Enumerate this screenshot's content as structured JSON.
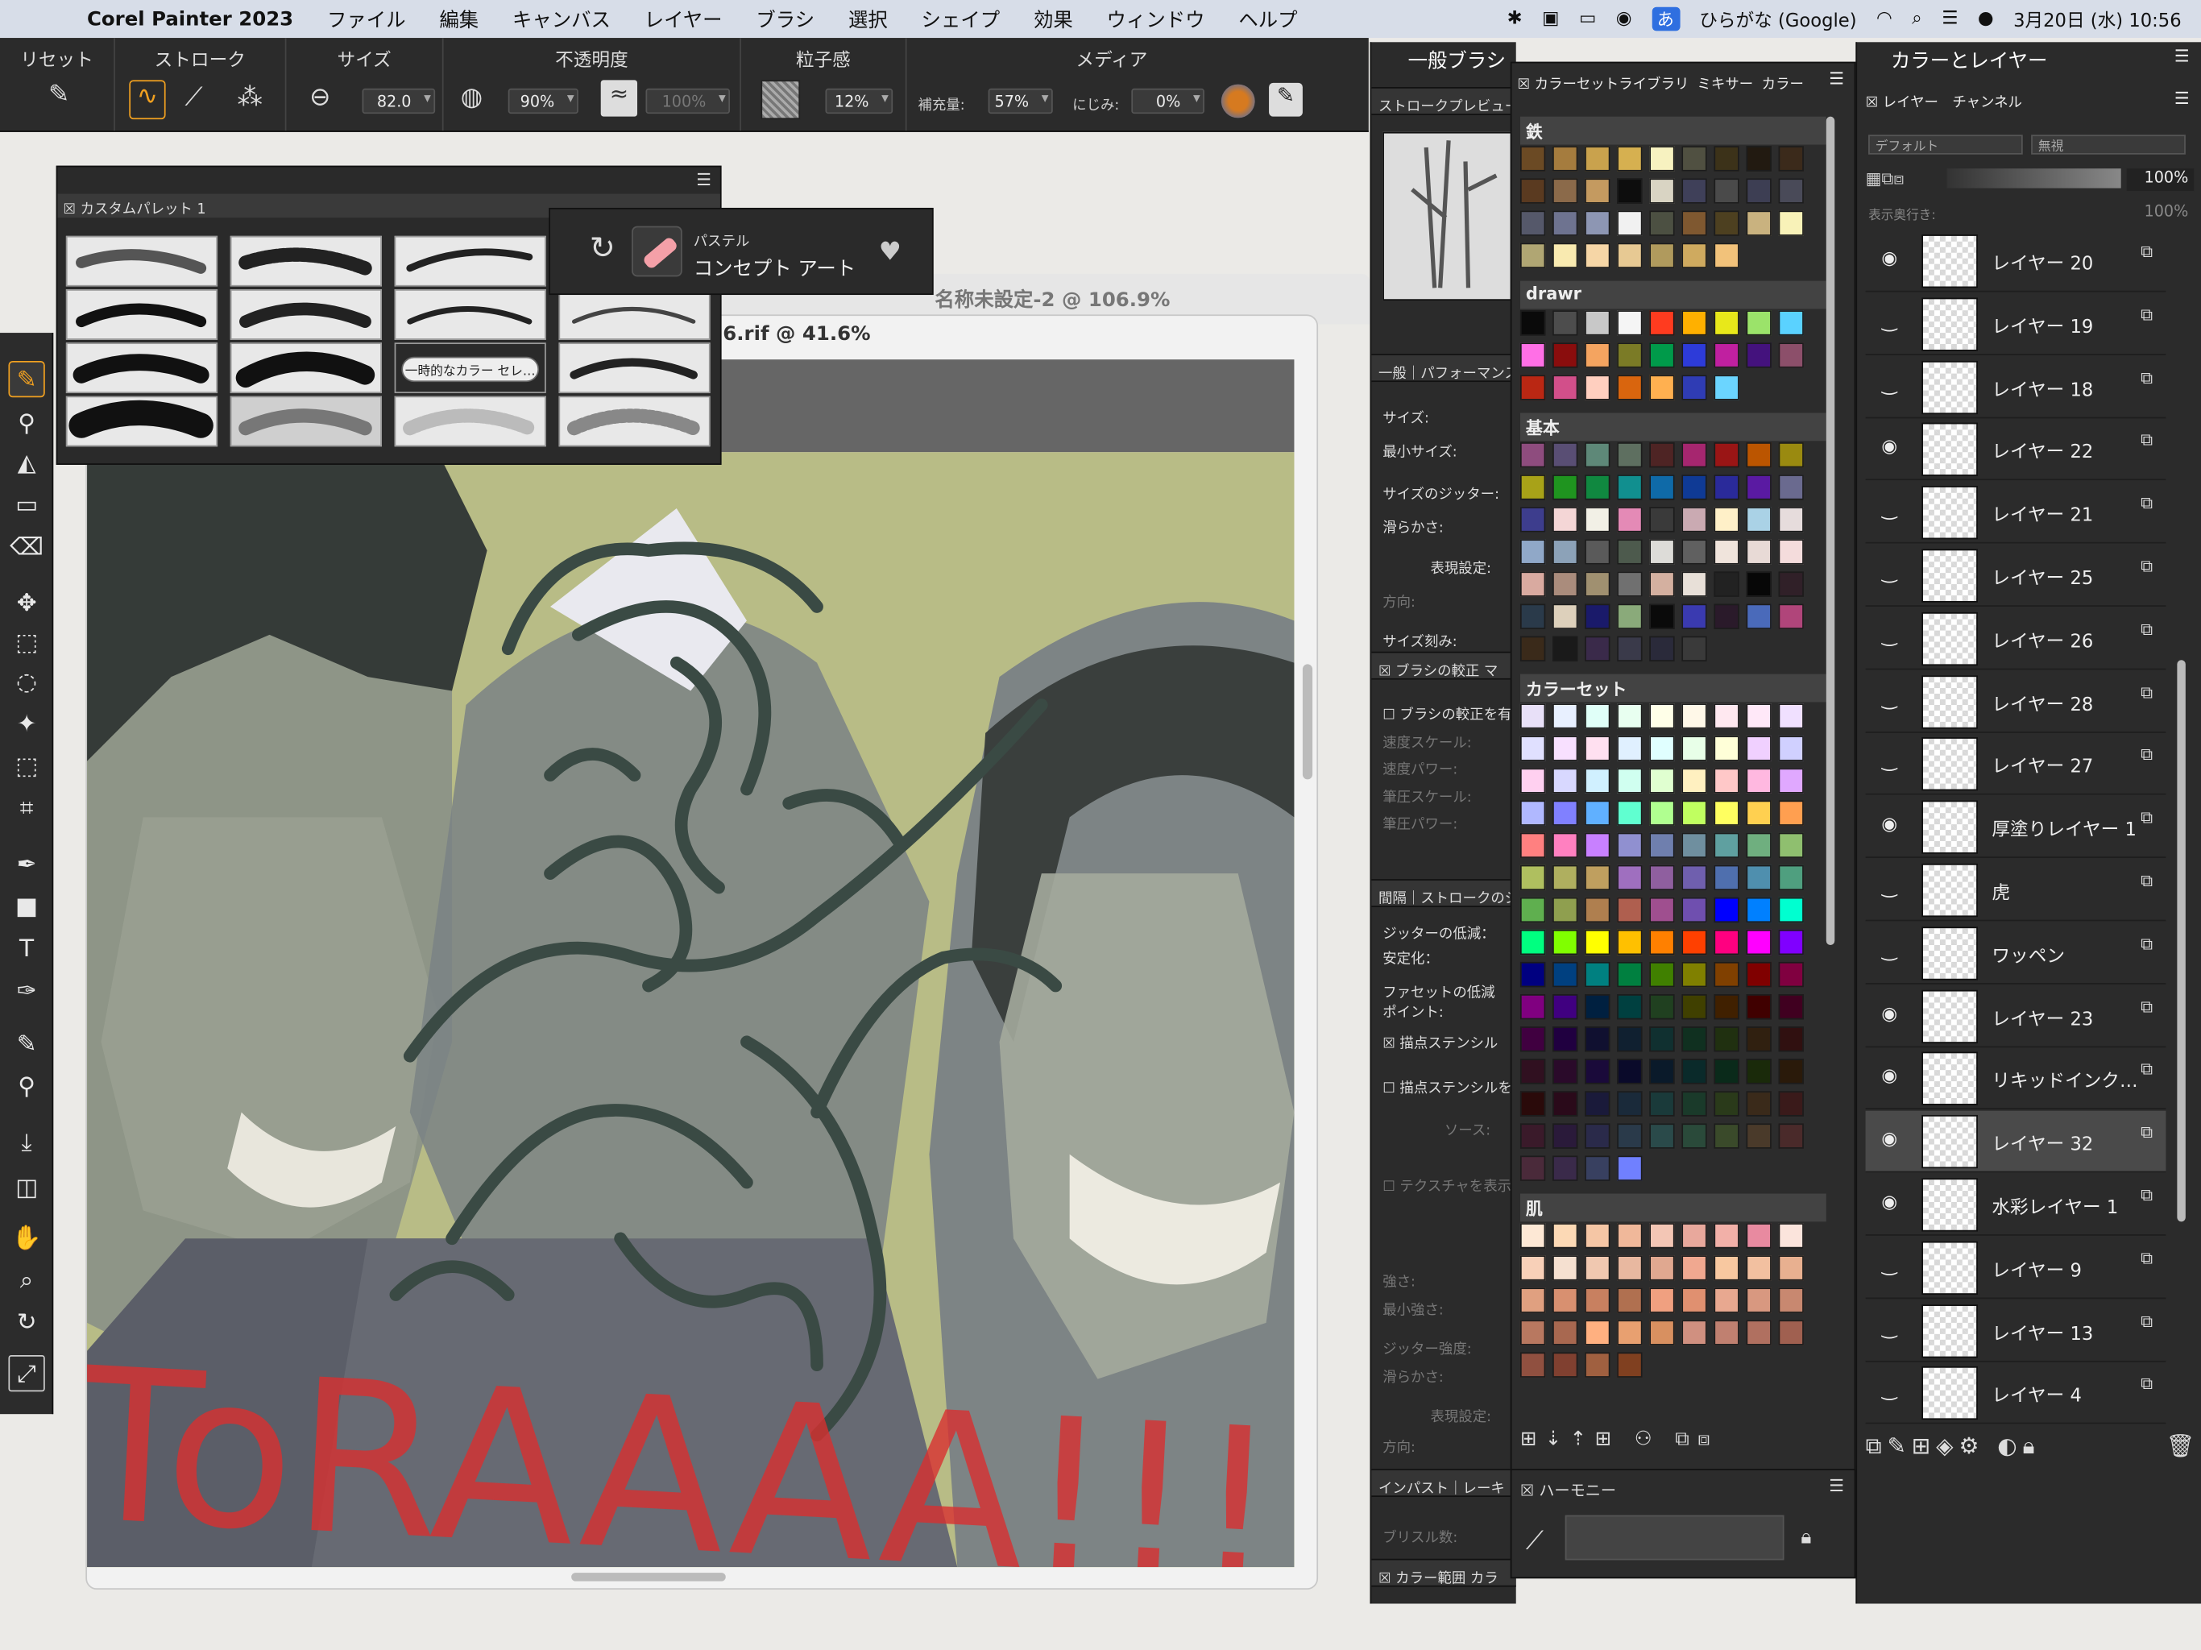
{
  "menubar": {
    "app_name": "Corel Painter 2023",
    "items": [
      "ファイル",
      "編集",
      "キャンバス",
      "レイヤー",
      "ブラシ",
      "選択",
      "シェイプ",
      "効果",
      "ウィンドウ",
      "ヘルプ"
    ],
    "ime_badge": "あ",
    "input_method": "ひらがな (Google)",
    "datetime": "3月20日 (水)  10:56"
  },
  "propbar": {
    "reset_label": "リセット",
    "stroke_label": "ストローク",
    "size_label": "サイズ",
    "size_value": "82.0",
    "opacity_label": "不透明度",
    "opacity_value": "90%",
    "opacity2_value": "100%",
    "grain_label": "粒子感",
    "grain_value": "12%",
    "media_label": "メディア",
    "resaturation_label": "補充量:",
    "resaturation_value": "57%",
    "bleed_label": "にじみ:",
    "bleed_value": "0%"
  },
  "document": {
    "back_title": "名称未設定-2 @ 106.9%",
    "title": "6.rif @ 41.6%",
    "handwriting": "ToRAAAA!!!"
  },
  "custom_palette": {
    "title": "カスタムパレット 1",
    "temp_color_label": "一時的なカラー セレ…"
  },
  "brush_selector": {
    "category": "パステル",
    "variant": "コンセプト アート"
  },
  "general_brush": {
    "title": "一般ブラシ",
    "stroke_preview": "ストロークプレビュー",
    "tabs": [
      "一般",
      "パフォーマンス"
    ],
    "rows": [
      "サイズ:",
      "最小サイズ:",
      "サイズのジッター:",
      "滑らかさ:",
      "表現設定:",
      "方向:",
      "サイズ刻み:"
    ],
    "calib_header": "ブラシの較正",
    "calib_tab": "マ",
    "calib_check": "ブラシの較正を有",
    "calib_rows": [
      "速度スケール:",
      "速度パワー:",
      "筆圧スケール:",
      "筆圧パワー:"
    ],
    "spacing_header": "間隔",
    "stroke_jitter": "ストロークのジ",
    "jitter_reduce": "ジッターの低減：",
    "stabilize": "安定化：",
    "facet_reduce": "ファセットの低減",
    "point": "ポイント:",
    "dab_stencil_header": "描点ステンシル",
    "dab_stencil_check": "描点ステンシルを",
    "source": "ソース:",
    "texture_check": "テクスチャを表示",
    "lower_rows": [
      "強さ:",
      "最小強さ:",
      "ジッター強度:",
      "滑らかさ:",
      "表現設定:",
      "方向:"
    ],
    "impasto_tab": "インパスト",
    "rake_tab": "レーキ",
    "bristle": "ブリスル数:",
    "color_range_header": "カラー範囲",
    "color_tab": "カラ"
  },
  "color_library": {
    "tabs": [
      "カラーセットライブラリ",
      "ミキサー",
      "カラー"
    ],
    "groups": [
      {
        "name": "鉄",
        "colors": [
          "#6b4a24",
          "#a57c3e",
          "#c9a24d",
          "#d6b050",
          "#f7f2c0",
          "#505041",
          "#3c3219",
          "#221a11",
          "#3b2a1b",
          "#5a3a20",
          "#8b6a4a",
          "#c49a60",
          "#0d0d0d",
          "#d9d4c3",
          "#3f4059",
          "#4a4a4a",
          "#3d3e53",
          "#494a58",
          "#55586a",
          "#6e7390",
          "#8d96b3",
          "#f1f1f1",
          "#4c5042",
          "#7f5830",
          "#4d4020",
          "#c9b27f",
          "#f8f2b8",
          "#b0a673",
          "#f9eab0",
          "#f6d6a6",
          "#e7c993",
          "#b09a5d",
          "#cfaa5f",
          "#f2c27a"
        ]
      },
      {
        "name": "drawr",
        "colors": [
          "#0a0a0a",
          "#4d4d4d",
          "#c8c8c8",
          "#f5f5f5",
          "#ff3b1f",
          "#ffb000",
          "#e8e81a",
          "#9be36a",
          "#5ad2ff",
          "#ff6fe6",
          "#8a0d0d",
          "#f4a460",
          "#7b7b26",
          "#009a4a",
          "#2d3bd9",
          "#c020a0",
          "#44127d",
          "#8c4f6a",
          "#ba2713",
          "#d24f8a",
          "#ffcfbf",
          "#d9650e",
          "#ffb050",
          "#2f3cb4",
          "#6bd5ff"
        ]
      },
      {
        "name": "基本",
        "colors": [
          "#8e4c7e",
          "#594e74",
          "#5e8878",
          "#5e6f60",
          "#4e2424",
          "#a6266f",
          "#9a1515",
          "#bb5500",
          "#9a8a10",
          "#a8a218",
          "#1f941f",
          "#108840",
          "#118f8f",
          "#0f6aa8",
          "#0f3a95",
          "#2a2a9a",
          "#5a1aa2",
          "#6a6a8f",
          "#3d3d8d",
          "#f4d6d6",
          "#f2f0e6",
          "#e48ab6",
          "#3a3a3a",
          "#caaab2",
          "#fff0c8",
          "#aad2e6",
          "#e6dcdc",
          "#90a8c8",
          "#8ca2b8",
          "#5a5a5a",
          "#4d5a4d",
          "#dddcd8",
          "#606060",
          "#f0e4dc",
          "#e8dad6",
          "#f4dcdc",
          "#d9aaa0",
          "#aa8c7c",
          "#a09070",
          "#707070",
          "#d4b0a0",
          "#e8e0d8",
          "#222222",
          "#070707",
          "#302028",
          "#2a3a4a",
          "#ddd0bb",
          "#1a1a6a",
          "#8aaa7a",
          "#0a0a0a",
          "#3a3ab0",
          "#2a1a2a",
          "#4a6aba",
          "#b0457a",
          "#3a2a1a",
          "#1a1a1a",
          "#3a2a4a",
          "#3a3a4a",
          "#2a2a3a",
          "#3a3a3a"
        ]
      },
      {
        "name": "カラーセット",
        "colors": [
          "#e8e0f8",
          "#e8f0ff",
          "#e0fff8",
          "#e8fff0",
          "#ffffe8",
          "#fff8e8",
          "#ffe8f0",
          "#ffe8f8",
          "#f0e0ff",
          "#e0e0ff",
          "#f8e0ff",
          "#ffe0f0",
          "#e0f0ff",
          "#e0ffff",
          "#e8ffe8",
          "#ffffd8",
          "#f0d0ff",
          "#d0d0ff",
          "#ffd0f0",
          "#d8d8ff",
          "#d0f0ff",
          "#d0fff0",
          "#e0ffd0",
          "#fff0c0",
          "#ffc8c8",
          "#ffb8e0",
          "#e0a8ff",
          "#b0b8ff",
          "#8080ff",
          "#60b0ff",
          "#60ffd0",
          "#b0ff90",
          "#c0ff60",
          "#ffff60",
          "#ffd050",
          "#ff9f50",
          "#ff8080",
          "#ff80c0",
          "#c880ff",
          "#9090d0",
          "#6f7fae",
          "#6f8f9f",
          "#5fa0a0",
          "#6faf7f",
          "#8fbf6f",
          "#afbf5f",
          "#afaf5f",
          "#bf9f5f",
          "#9f6fbf",
          "#8f5f9f",
          "#6f5fae",
          "#4f6fae",
          "#4f8fae",
          "#4f9f7f",
          "#5faf4f",
          "#8f9f4f",
          "#af7f4f",
          "#af5f4f",
          "#9f4f8f",
          "#6f4faf",
          "#0000ff",
          "#0080ff",
          "#00ffd0",
          "#00ff80",
          "#80ff00",
          "#ffff00",
          "#ffc000",
          "#ff8000",
          "#ff4000",
          "#ff0080",
          "#ff00ff",
          "#8000ff",
          "#000080",
          "#004080",
          "#008080",
          "#008040",
          "#408000",
          "#808000",
          "#804000",
          "#800000",
          "#800040",
          "#800080",
          "#400080",
          "#002040",
          "#004040",
          "#204020",
          "#404000",
          "#402000",
          "#400000",
          "#400020",
          "#400040",
          "#200040",
          "#101030",
          "#102030",
          "#103030",
          "#103020",
          "#203010",
          "#302010",
          "#301010",
          "#301020",
          "#2a0a2a",
          "#1a0a3a",
          "#0a0a2a",
          "#0a1a2a",
          "#0a2a2a",
          "#0a2a1a",
          "#1a2a0a",
          "#2a1a0a",
          "#2a0a0a",
          "#2a0a1a",
          "#1a1a3a",
          "#1a2a3a",
          "#1a3a3a",
          "#1a3a2a",
          "#2a3a1a",
          "#3a2a1a",
          "#3a1a1a",
          "#3a1a2a",
          "#2a1a3a",
          "#2a2a4a",
          "#2a3a4a",
          "#2a4a4a",
          "#2a4a3a",
          "#3a4a2a",
          "#4a3a2a",
          "#4a2a2a",
          "#4a2a3a",
          "#3a2a4a",
          "#384060",
          "#7080ff"
        ]
      },
      {
        "name": "肌",
        "colors": [
          "#fde8d5",
          "#fcd9b5",
          "#f5c6a5",
          "#f0b89a",
          "#f3c6b5",
          "#e8a89c",
          "#f2b0a8",
          "#e88aa0",
          "#fbe4dc",
          "#f8d0b8",
          "#f5e0d0",
          "#f0c8b0",
          "#e8b8a0",
          "#e0a890",
          "#f0a890",
          "#f8c8a0",
          "#f2c0a0",
          "#e8b090",
          "#e0a080",
          "#d89070",
          "#c88060",
          "#b07050",
          "#f0a080",
          "#e09070",
          "#e8a890",
          "#d89880",
          "#c88870",
          "#b87860",
          "#a86850",
          "#ffb080",
          "#e8a070",
          "#d89060",
          "#d09080",
          "#c08070",
          "#b07060",
          "#a06050",
          "#905040",
          "#804030",
          "#a06040",
          "#804020"
        ]
      }
    ],
    "harmony_title": "ハーモニー"
  },
  "layers_panel": {
    "title": "カラーとレイヤー",
    "tabs": [
      "レイヤー",
      "チャンネル"
    ],
    "composite_method": "デフォルト",
    "composite_depth": "無視",
    "opacity": "100%",
    "depth_label": "表示奥行き:",
    "depth_value": "100%",
    "layers": [
      {
        "name": "レイヤー 20",
        "visible": true
      },
      {
        "name": "レイヤー 19",
        "visible": false
      },
      {
        "name": "レイヤー 18",
        "visible": false
      },
      {
        "name": "レイヤー 22",
        "visible": true
      },
      {
        "name": "レイヤー 21",
        "visible": false
      },
      {
        "name": "レイヤー 25",
        "visible": false
      },
      {
        "name": "レイヤー 26",
        "visible": false
      },
      {
        "name": "レイヤー 28",
        "visible": false
      },
      {
        "name": "レイヤー 27",
        "visible": false
      },
      {
        "name": "厚塗りレイヤー 1",
        "visible": true
      },
      {
        "name": "虎",
        "visible": false
      },
      {
        "name": "ワッペン",
        "visible": false
      },
      {
        "name": "レイヤー 23",
        "visible": true
      },
      {
        "name": "リキッドインク…",
        "visible": true
      },
      {
        "name": "レイヤー 32",
        "visible": true,
        "selected": true
      },
      {
        "name": "水彩レイヤー 1",
        "visible": true
      },
      {
        "name": "レイヤー 9",
        "visible": false
      },
      {
        "name": "レイヤー 13",
        "visible": false
      },
      {
        "name": "レイヤー 4",
        "visible": false
      }
    ]
  },
  "colors": {
    "accent": "#f0a020",
    "panel_bg": "#2b2b2b",
    "canvas_bg": "#b9bd88",
    "stroke": "#3a4a44",
    "handwriting": "#d83030"
  }
}
